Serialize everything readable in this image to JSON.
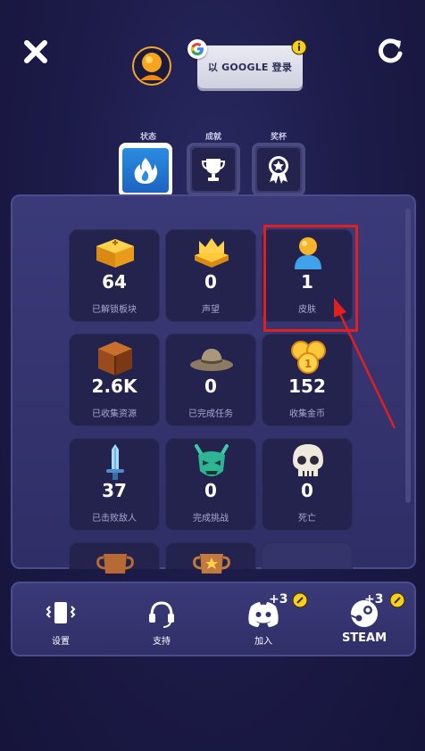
{
  "google_button_label": "以 GOOGLE 登录",
  "tabs": [
    {
      "label": "状态",
      "icon": "flame-icon",
      "active": true
    },
    {
      "label": "成就",
      "icon": "trophy-icon",
      "active": false
    },
    {
      "label": "奖杯",
      "icon": "badge-star-icon",
      "active": false
    }
  ],
  "stats": [
    {
      "value": "64",
      "label": "已解锁板块",
      "icon": "gold-tile-icon"
    },
    {
      "value": "0",
      "label": "声望",
      "icon": "crown-icon"
    },
    {
      "value": "1",
      "label": "皮肤",
      "icon": "character-skin-icon"
    },
    {
      "value": "2.6K",
      "label": "已收集资源",
      "icon": "wood-crate-icon"
    },
    {
      "value": "0",
      "label": "已完成任务",
      "icon": "explorer-hat-icon"
    },
    {
      "value": "152",
      "label": "收集金币",
      "icon": "gold-coins-icon"
    },
    {
      "value": "37",
      "label": "已击败敌人",
      "icon": "sword-icon"
    },
    {
      "value": "0",
      "label": "完成挑战",
      "icon": "demon-mask-icon"
    },
    {
      "value": "0",
      "label": "死亡",
      "icon": "skull-icon"
    }
  ],
  "bottom_nav": [
    {
      "label": "设置",
      "icon": "phone-vibrate-icon",
      "badge": ""
    },
    {
      "label": "支持",
      "icon": "headset-icon",
      "badge": ""
    },
    {
      "label": "加入",
      "icon": "discord-icon",
      "badge": "+3"
    },
    {
      "label": "STEAM",
      "icon": "steam-icon",
      "badge": "+3"
    }
  ],
  "colors": {
    "background": "#1d1c4a",
    "panel": "#3b3a79",
    "card": "#24234d",
    "active_tab": "#2b8ce0",
    "highlight": "#e01f1f",
    "gold": "#f7b52b"
  }
}
